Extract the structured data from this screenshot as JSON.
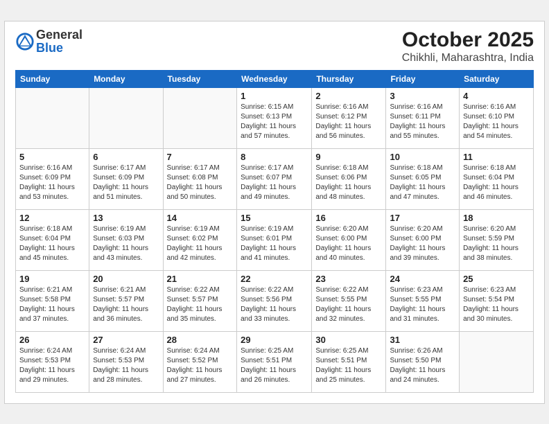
{
  "header": {
    "logo_general": "General",
    "logo_blue": "Blue",
    "month": "October 2025",
    "location": "Chikhli, Maharashtra, India"
  },
  "weekdays": [
    "Sunday",
    "Monday",
    "Tuesday",
    "Wednesday",
    "Thursday",
    "Friday",
    "Saturday"
  ],
  "weeks": [
    [
      {
        "day": "",
        "info": ""
      },
      {
        "day": "",
        "info": ""
      },
      {
        "day": "",
        "info": ""
      },
      {
        "day": "1",
        "info": "Sunrise: 6:15 AM\nSunset: 6:13 PM\nDaylight: 11 hours\nand 57 minutes."
      },
      {
        "day": "2",
        "info": "Sunrise: 6:16 AM\nSunset: 6:12 PM\nDaylight: 11 hours\nand 56 minutes."
      },
      {
        "day": "3",
        "info": "Sunrise: 6:16 AM\nSunset: 6:11 PM\nDaylight: 11 hours\nand 55 minutes."
      },
      {
        "day": "4",
        "info": "Sunrise: 6:16 AM\nSunset: 6:10 PM\nDaylight: 11 hours\nand 54 minutes."
      }
    ],
    [
      {
        "day": "5",
        "info": "Sunrise: 6:16 AM\nSunset: 6:09 PM\nDaylight: 11 hours\nand 53 minutes."
      },
      {
        "day": "6",
        "info": "Sunrise: 6:17 AM\nSunset: 6:09 PM\nDaylight: 11 hours\nand 51 minutes."
      },
      {
        "day": "7",
        "info": "Sunrise: 6:17 AM\nSunset: 6:08 PM\nDaylight: 11 hours\nand 50 minutes."
      },
      {
        "day": "8",
        "info": "Sunrise: 6:17 AM\nSunset: 6:07 PM\nDaylight: 11 hours\nand 49 minutes."
      },
      {
        "day": "9",
        "info": "Sunrise: 6:18 AM\nSunset: 6:06 PM\nDaylight: 11 hours\nand 48 minutes."
      },
      {
        "day": "10",
        "info": "Sunrise: 6:18 AM\nSunset: 6:05 PM\nDaylight: 11 hours\nand 47 minutes."
      },
      {
        "day": "11",
        "info": "Sunrise: 6:18 AM\nSunset: 6:04 PM\nDaylight: 11 hours\nand 46 minutes."
      }
    ],
    [
      {
        "day": "12",
        "info": "Sunrise: 6:18 AM\nSunset: 6:04 PM\nDaylight: 11 hours\nand 45 minutes."
      },
      {
        "day": "13",
        "info": "Sunrise: 6:19 AM\nSunset: 6:03 PM\nDaylight: 11 hours\nand 43 minutes."
      },
      {
        "day": "14",
        "info": "Sunrise: 6:19 AM\nSunset: 6:02 PM\nDaylight: 11 hours\nand 42 minutes."
      },
      {
        "day": "15",
        "info": "Sunrise: 6:19 AM\nSunset: 6:01 PM\nDaylight: 11 hours\nand 41 minutes."
      },
      {
        "day": "16",
        "info": "Sunrise: 6:20 AM\nSunset: 6:00 PM\nDaylight: 11 hours\nand 40 minutes."
      },
      {
        "day": "17",
        "info": "Sunrise: 6:20 AM\nSunset: 6:00 PM\nDaylight: 11 hours\nand 39 minutes."
      },
      {
        "day": "18",
        "info": "Sunrise: 6:20 AM\nSunset: 5:59 PM\nDaylight: 11 hours\nand 38 minutes."
      }
    ],
    [
      {
        "day": "19",
        "info": "Sunrise: 6:21 AM\nSunset: 5:58 PM\nDaylight: 11 hours\nand 37 minutes."
      },
      {
        "day": "20",
        "info": "Sunrise: 6:21 AM\nSunset: 5:57 PM\nDaylight: 11 hours\nand 36 minutes."
      },
      {
        "day": "21",
        "info": "Sunrise: 6:22 AM\nSunset: 5:57 PM\nDaylight: 11 hours\nand 35 minutes."
      },
      {
        "day": "22",
        "info": "Sunrise: 6:22 AM\nSunset: 5:56 PM\nDaylight: 11 hours\nand 33 minutes."
      },
      {
        "day": "23",
        "info": "Sunrise: 6:22 AM\nSunset: 5:55 PM\nDaylight: 11 hours\nand 32 minutes."
      },
      {
        "day": "24",
        "info": "Sunrise: 6:23 AM\nSunset: 5:55 PM\nDaylight: 11 hours\nand 31 minutes."
      },
      {
        "day": "25",
        "info": "Sunrise: 6:23 AM\nSunset: 5:54 PM\nDaylight: 11 hours\nand 30 minutes."
      }
    ],
    [
      {
        "day": "26",
        "info": "Sunrise: 6:24 AM\nSunset: 5:53 PM\nDaylight: 11 hours\nand 29 minutes."
      },
      {
        "day": "27",
        "info": "Sunrise: 6:24 AM\nSunset: 5:53 PM\nDaylight: 11 hours\nand 28 minutes."
      },
      {
        "day": "28",
        "info": "Sunrise: 6:24 AM\nSunset: 5:52 PM\nDaylight: 11 hours\nand 27 minutes."
      },
      {
        "day": "29",
        "info": "Sunrise: 6:25 AM\nSunset: 5:51 PM\nDaylight: 11 hours\nand 26 minutes."
      },
      {
        "day": "30",
        "info": "Sunrise: 6:25 AM\nSunset: 5:51 PM\nDaylight: 11 hours\nand 25 minutes."
      },
      {
        "day": "31",
        "info": "Sunrise: 6:26 AM\nSunset: 5:50 PM\nDaylight: 11 hours\nand 24 minutes."
      },
      {
        "day": "",
        "info": ""
      }
    ]
  ]
}
